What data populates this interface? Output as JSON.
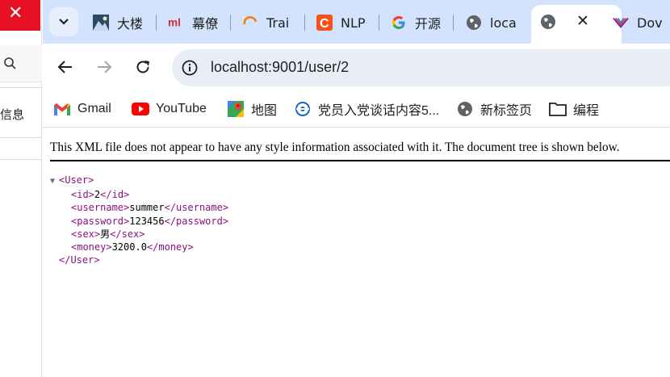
{
  "left_window": {
    "close_glyph": "✕",
    "partial_text": "信息"
  },
  "tabs": [
    {
      "label": "大楼",
      "icon": "mountain-favicon"
    },
    {
      "label": "幕僚",
      "icon": "ml-favicon"
    },
    {
      "label": "Trai",
      "icon": "swirl-favicon"
    },
    {
      "label": "NLP",
      "icon": "c-favicon"
    },
    {
      "label": "开源",
      "icon": "google-favicon"
    },
    {
      "label": "loca",
      "icon": "globe-favicon"
    }
  ],
  "active_tab": {
    "icon": "globe-favicon",
    "close_glyph": "✕"
  },
  "last_tab": {
    "label": "Dov",
    "icon": "stripes-favicon"
  },
  "address_bar": {
    "url": "localhost:9001/user/2"
  },
  "bookmarks": [
    {
      "label": "Gmail",
      "icon": "gmail-icon"
    },
    {
      "label": "YouTube",
      "icon": "youtube-icon"
    },
    {
      "label": "地图",
      "icon": "maps-icon"
    },
    {
      "label": "党员入党谈话内容5...",
      "icon": "bookmark-favicon"
    },
    {
      "label": "新标签页",
      "icon": "globe-icon"
    },
    {
      "label": "编程",
      "icon": "folder-icon"
    }
  ],
  "xml_viewer": {
    "notice": "This XML file does not appear to have any style information associated with it. The document tree is shown below.",
    "root_open": "<User>",
    "root_close": "</User>",
    "fields": [
      {
        "open": "<id>",
        "value": "2",
        "close": "</id>"
      },
      {
        "open": "<username>",
        "value": "summer",
        "close": "</username>"
      },
      {
        "open": "<password>",
        "value": "123456",
        "close": "</password>"
      },
      {
        "open": "<sex>",
        "value": "男",
        "close": "</sex>"
      },
      {
        "open": "<money>",
        "value": "3200.0",
        "close": "</money>"
      }
    ],
    "collapse_glyph": "▼"
  }
}
